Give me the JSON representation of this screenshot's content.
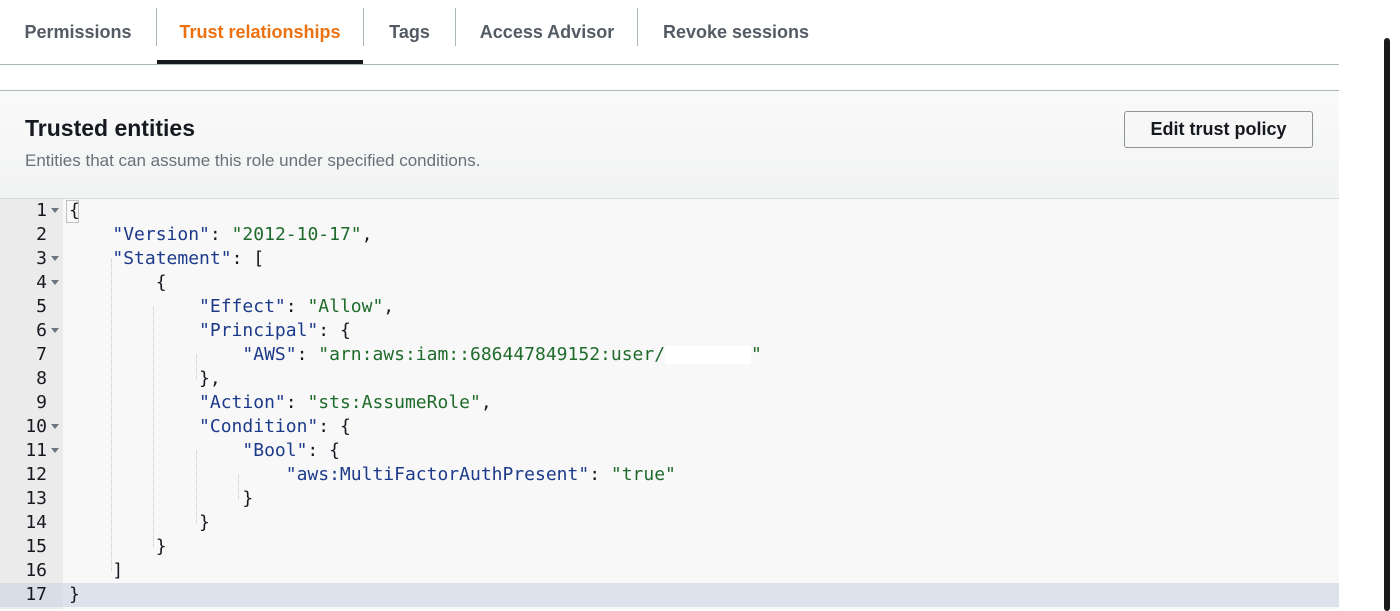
{
  "tabs": [
    {
      "label": "Permissions",
      "active": false
    },
    {
      "label": "Trust relationships",
      "active": true
    },
    {
      "label": "Tags",
      "active": false
    },
    {
      "label": "Access Advisor",
      "active": false
    },
    {
      "label": "Revoke sessions",
      "active": false
    }
  ],
  "panel": {
    "title": "Trusted entities",
    "description": "Entities that can assume this role under specified conditions.",
    "edit_button": "Edit trust policy"
  },
  "editor": {
    "active_line": 17,
    "foldable_lines": [
      1,
      3,
      4,
      6,
      10,
      11
    ],
    "line_numbers": [
      "1",
      "2",
      "3",
      "4",
      "5",
      "6",
      "7",
      "8",
      "9",
      "10",
      "11",
      "12",
      "13",
      "14",
      "15",
      "16",
      "17"
    ],
    "tokens": {
      "l1_open": "{",
      "l2_key": "\"Version\"",
      "l2_val": "\"2012-10-17\"",
      "l3_key": "\"Statement\"",
      "l3_open": "[",
      "l4_open": "{",
      "l5_key": "\"Effect\"",
      "l5_val": "\"Allow\"",
      "l6_key": "\"Principal\"",
      "l6_open": "{",
      "l7_key": "\"AWS\"",
      "l7_val": "\"arn:aws:iam::686447849152:user/",
      "l7_val_end": "\"",
      "l8_close": "},",
      "l9_key": "\"Action\"",
      "l9_val": "\"sts:AssumeRole\"",
      "l10_key": "\"Condition\"",
      "l10_open": "{",
      "l11_key": "\"Bool\"",
      "l11_open": "{",
      "l12_key": "\"aws:MultiFactorAuthPresent\"",
      "l12_val": "\"true\"",
      "l13_close": "}",
      "l14_close": "}",
      "l15_close": "}",
      "l16_close": "]",
      "l17_close": "}"
    }
  },
  "colors": {
    "accent": "#ec7211",
    "json_key": "#1d3a8a",
    "json_string": "#1f6b2b",
    "active_line": "#dde3ec"
  }
}
